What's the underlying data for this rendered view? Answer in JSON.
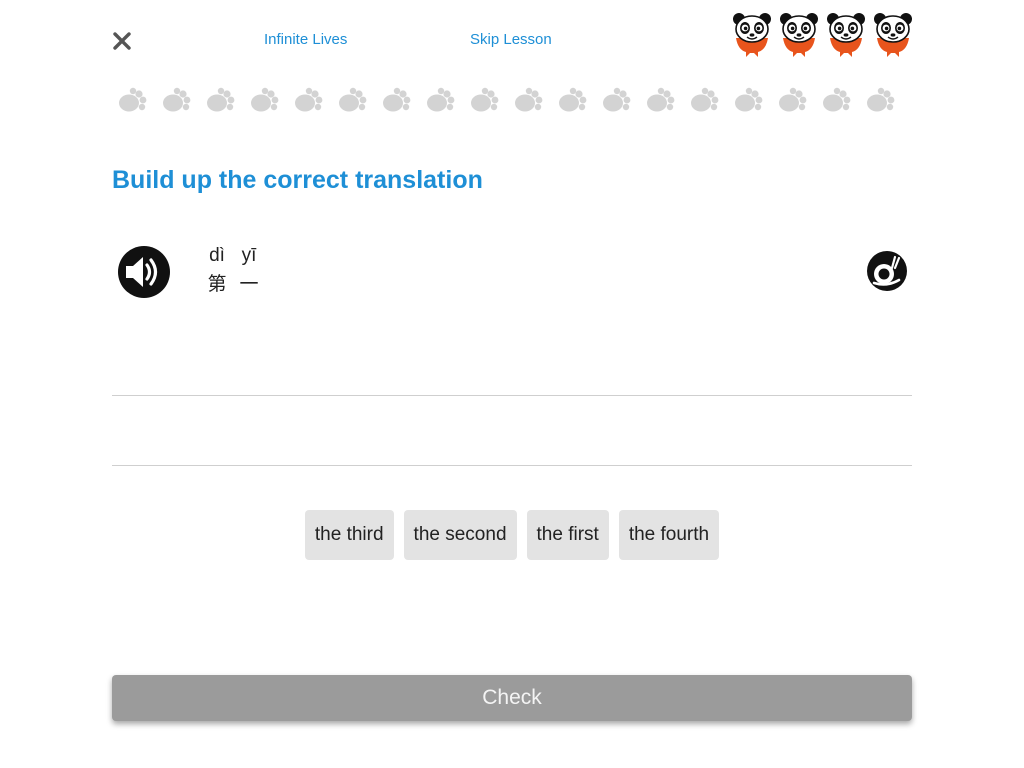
{
  "header": {
    "close_icon": "close-icon",
    "infinite_lives_label": "Infinite Lives",
    "skip_lesson_label": "Skip Lesson",
    "lives_count": 4,
    "lives_icon": "panda-head-icon"
  },
  "progress": {
    "total_steps": 18,
    "completed_steps": 0,
    "step_icon": "paw-print-icon"
  },
  "exercise": {
    "instruction": "Build up the correct translation",
    "audio_icon": "speaker-icon",
    "slow_audio_icon": "snail-icon",
    "syllables": [
      {
        "pinyin": "dì",
        "hanzi": "第"
      },
      {
        "pinyin": "yī",
        "hanzi": "一"
      }
    ],
    "answer_words": []
  },
  "word_bank": [
    "the third",
    "the second",
    "the first",
    "the fourth"
  ],
  "footer": {
    "check_label": "Check"
  },
  "colors": {
    "accent": "#1e8fd6",
    "chip_bg": "#e3e3e3",
    "check_disabled": "#9b9b9b",
    "paw_inactive": "#d3d3d3",
    "panda_orange": "#e8541c"
  }
}
